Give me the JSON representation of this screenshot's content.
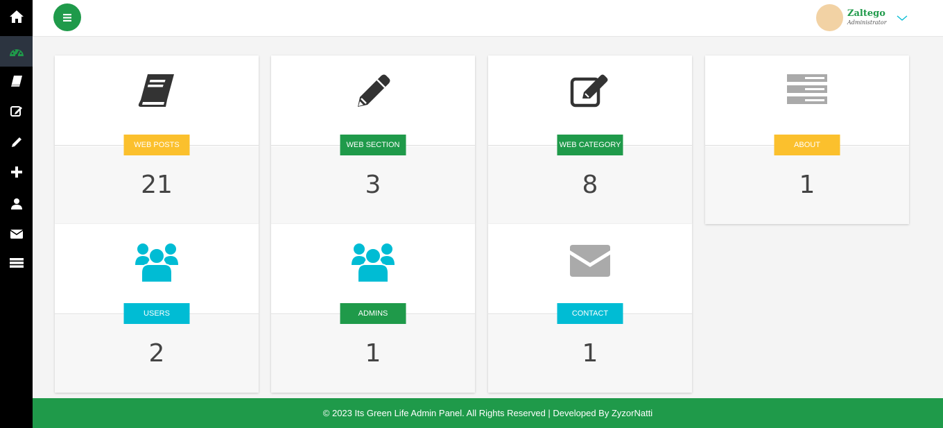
{
  "sidebar": {
    "items": [
      {
        "icon": "home-icon"
      },
      {
        "icon": "dashboard-icon",
        "active": true
      },
      {
        "icon": "book-icon"
      },
      {
        "icon": "edit-icon"
      },
      {
        "icon": "pencil-icon"
      },
      {
        "icon": "plus-icon"
      },
      {
        "icon": "user-icon"
      },
      {
        "icon": "envelope-icon"
      },
      {
        "icon": "server-icon"
      }
    ]
  },
  "header": {
    "menu_icon": "bars-icon",
    "user": {
      "name": "Zaltego",
      "role": "Administrator"
    }
  },
  "cards": [
    {
      "label": "WEB POSTS",
      "value": "21",
      "icon": "book-icon",
      "label_color": "#fbc02d"
    },
    {
      "label": "WEB SECTION",
      "value": "3",
      "icon": "pencil-icon",
      "label_color": "#1f9a4a"
    },
    {
      "label": "WEB CATEGORY",
      "value": "8",
      "icon": "edit-icon",
      "label_color": "#1f9a4a"
    },
    {
      "label": "ABOUT",
      "value": "1",
      "icon": "server-icon",
      "label_color": "#fbc02d"
    },
    {
      "label": "USERS",
      "value": "2",
      "icon": "users-icon",
      "label_color": "#00bcd4"
    },
    {
      "label": "ADMINS",
      "value": "1",
      "icon": "users-icon",
      "label_color": "#1f9a4a"
    },
    {
      "label": "CONTACT",
      "value": "1",
      "icon": "envelope-icon",
      "label_color": "#00bcd4"
    }
  ],
  "footer": {
    "text": "© 2023 Its Green Life Admin Panel. All Rights Reserved | Developed By ZyzorNatti"
  },
  "colors": {
    "brand": "#1f9a4a",
    "yellow": "#fbc02d",
    "cyan": "#00bcd4",
    "sidebar": "#000000"
  }
}
